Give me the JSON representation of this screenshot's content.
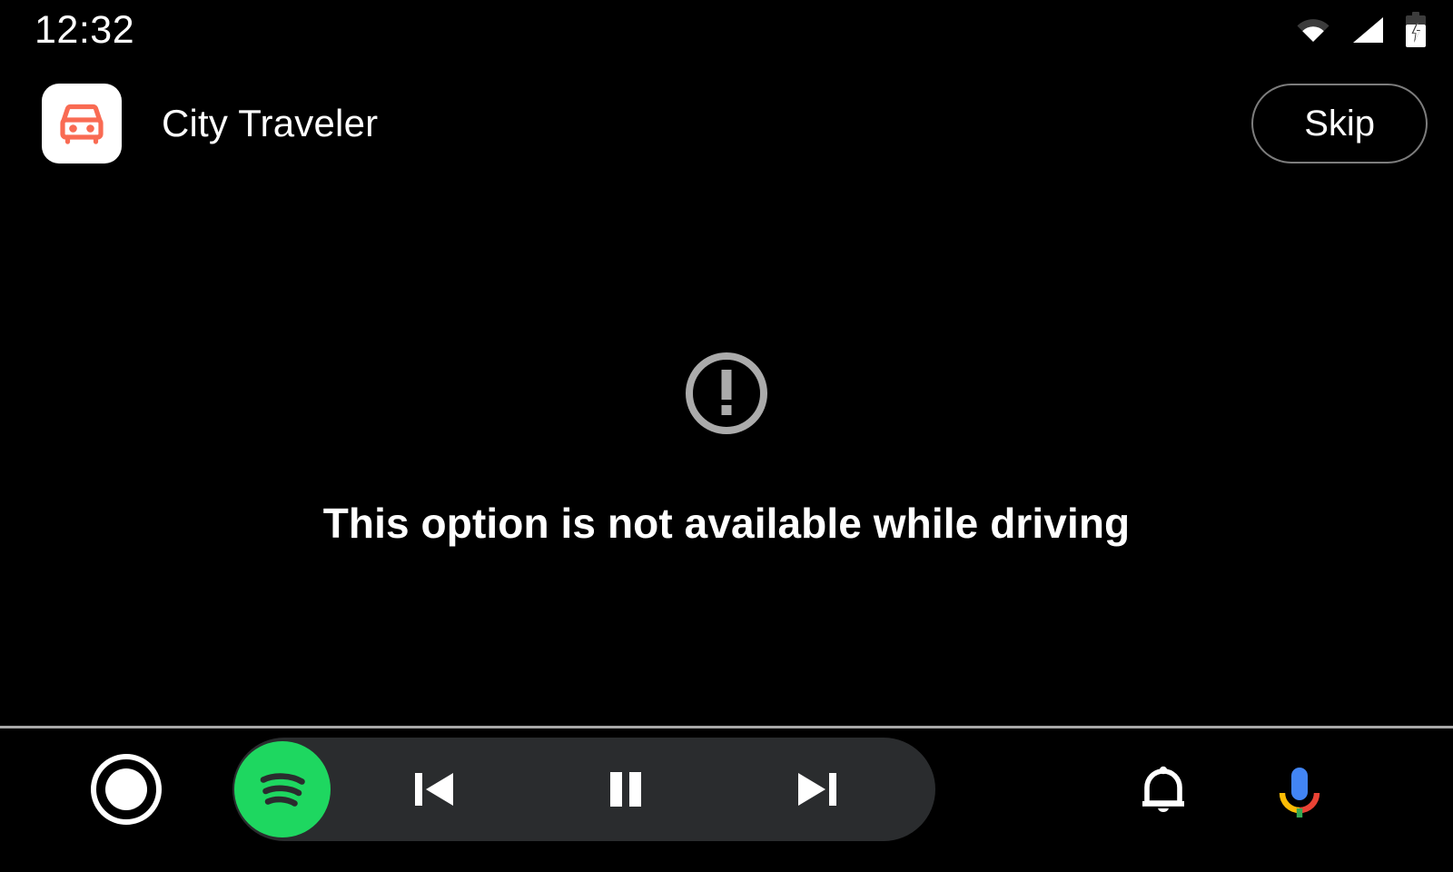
{
  "status_bar": {
    "clock": "12:32",
    "icons": {
      "wifi": "wifi-icon",
      "cellular": "cellular-signal-icon",
      "battery": "battery-charging-icon"
    }
  },
  "header": {
    "app_icon": "car-app-icon",
    "app_title": "City Traveler",
    "skip_label": "Skip"
  },
  "main": {
    "warning_icon": "error-circle-icon",
    "message": "This option is not available while driving"
  },
  "nav_bar": {
    "home": "home-circle-icon",
    "media": {
      "app_badge": "spotify-icon",
      "previous": "skip-previous-icon",
      "play_pause": "pause-icon",
      "next": "skip-next-icon"
    },
    "notifications": "bell-icon",
    "assistant": "google-assistant-mic-icon"
  },
  "colors": {
    "background": "#000000",
    "app_icon_bg": "#ffffff",
    "car_glyph": "#F96B53",
    "text_primary": "#ffffff",
    "warning_gray": "#ababab",
    "divider": "#a8a8a8",
    "media_pill": "#2a2c2e",
    "spotify_green": "#1ED760",
    "skip_border": "#7d7d7d",
    "google_blue": "#4285F4",
    "google_red": "#EA4335",
    "google_yellow": "#FBBC05",
    "google_green": "#34A853"
  }
}
